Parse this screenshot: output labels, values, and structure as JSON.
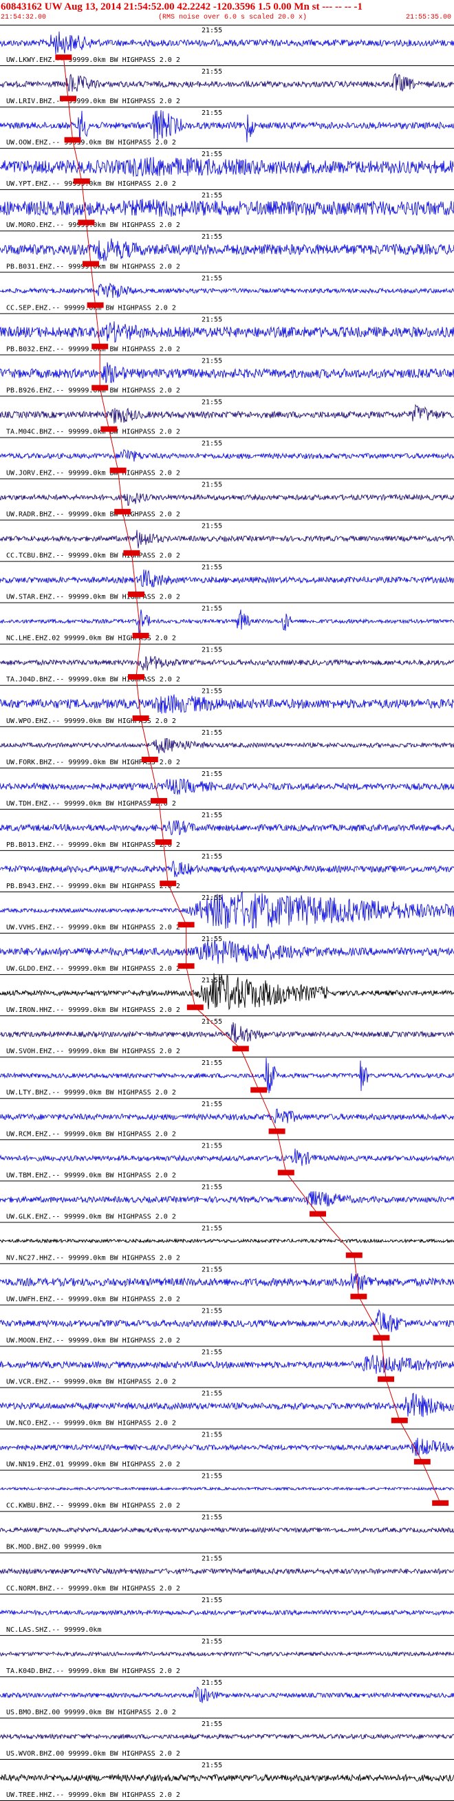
{
  "header": {
    "title": "60843162 UW Aug 13, 2014 21:54:52.00   42.2242 -120.3596  1.5 0.00 Mn st --- -- --  -1",
    "start_time": "21:54:32.00",
    "noise_note": "(RMS noise over 6.0 s scaled 20.0 x)",
    "end_time": "21:55:35.00"
  },
  "colors": {
    "trace_primary": "#1111dd",
    "trace_dark": "#22117a",
    "trace_black": "#000000",
    "pick": "#dd0000",
    "header_text": "#e00000"
  },
  "chart_data": {
    "type": "seismogram",
    "time_start": "21:54:32.00",
    "time_end": "21:55:35.00",
    "center_label": "21:55",
    "traces": [
      {
        "label": "UW.LKWY.EHZ.-- 99999.0km BW  HIGHPASS  2.0  2",
        "pick": 0.14,
        "color": "blue",
        "amp": 0.5,
        "bursts": [
          [
            0.1,
            0.22,
            2.2
          ]
        ]
      },
      {
        "label": "UW.LRIV.BHZ.-- 99999.0km BW  HIGHPASS  2.0  2",
        "pick": 0.15,
        "color": "dark",
        "amp": 0.45,
        "bursts": [
          [
            0.14,
            0.22,
            2.0
          ],
          [
            0.86,
            0.92,
            2.0
          ]
        ]
      },
      {
        "label": "UW.OOW.EHZ.-- 99999.0km BW  HIGHPASS  2.0  2",
        "pick": 0.16,
        "color": "blue",
        "amp": 0.5,
        "bursts": [
          [
            0.17,
            0.2,
            3.5
          ],
          [
            0.33,
            0.4,
            3.5
          ],
          [
            0.54,
            0.56,
            3.5
          ]
        ]
      },
      {
        "label": "UW.YPT.EHZ.-- 99999.0km BW  HIGHPASS  2.0  2",
        "pick": 0.18,
        "color": "blue",
        "amp": 1.0,
        "bursts": [
          [
            0.18,
            1.0,
            1.8
          ]
        ]
      },
      {
        "label": "UW.MORO.EHZ.-- 99999.0km BW  HIGHPASS  2.0  2",
        "pick": 0.19,
        "color": "blue",
        "amp": 1.1,
        "bursts": [
          [
            0.19,
            1.0,
            1.6
          ]
        ]
      },
      {
        "label": "PB.B031.EHZ.-- 99999.0km BW  HIGHPASS  2.0  2",
        "pick": 0.2,
        "color": "blue",
        "amp": 0.8,
        "bursts": [
          [
            0.2,
            0.35,
            2.2
          ]
        ]
      },
      {
        "label": "CC.SEP.EHZ.-- 99999.0km BW  HIGHPASS  2.0  2",
        "pick": 0.21,
        "color": "blue",
        "amp": 0.35,
        "bursts": [
          [
            0.21,
            0.3,
            1.8
          ]
        ]
      },
      {
        "label": "PB.B032.EHZ.-- 99999.0km BW  HIGHPASS  2.0  2",
        "pick": 0.22,
        "color": "blue",
        "amp": 0.8,
        "bursts": [
          [
            0.22,
            0.35,
            2.0
          ]
        ]
      },
      {
        "label": "PB.B926.EHZ.-- 99999.0km BW  HIGHPASS  2.0  2",
        "pick": 0.22,
        "color": "blue",
        "amp": 0.7,
        "bursts": [
          [
            0.22,
            0.3,
            2.0
          ]
        ]
      },
      {
        "label": "TA.M04C.BHZ.-- 99999.0km BW  HIGHPASS  2.0  2",
        "pick": 0.24,
        "color": "dark",
        "amp": 0.5,
        "bursts": [
          [
            0.24,
            0.32,
            1.8
          ],
          [
            0.9,
            0.98,
            1.8
          ]
        ]
      },
      {
        "label": "UW.JORV.EHZ.-- 99999.0km BW  HIGHPASS  2.0  2",
        "pick": 0.26,
        "color": "blue",
        "amp": 0.4,
        "bursts": [
          [
            0.26,
            0.32,
            1.6
          ]
        ]
      },
      {
        "label": "UW.RADR.BHZ.-- 99999.0km BW  HIGHPASS  2.0  2",
        "pick": 0.27,
        "color": "dark",
        "amp": 0.4,
        "bursts": [
          [
            0.27,
            0.33,
            1.6
          ]
        ]
      },
      {
        "label": "CC.TCBU.BHZ.-- 99999.0km BW  HIGHPASS  2.0  2",
        "pick": 0.29,
        "color": "dark",
        "amp": 0.4,
        "bursts": [
          [
            0.29,
            0.36,
            1.8
          ]
        ]
      },
      {
        "label": "UW.STAR.EHZ.-- 99999.0km BW  HIGHPASS  2.0  2",
        "pick": 0.3,
        "color": "blue",
        "amp": 0.45,
        "bursts": [
          [
            0.3,
            0.38,
            2.0
          ]
        ]
      },
      {
        "label": "NC.LHE.EHZ.02 99999.0km BW  HIGHPASS  2.0  2",
        "pick": 0.31,
        "color": "blue",
        "amp": 0.3,
        "bursts": [
          [
            0.3,
            0.33,
            2.5
          ],
          [
            0.52,
            0.55,
            2.5
          ],
          [
            0.62,
            0.64,
            2.5
          ]
        ]
      },
      {
        "label": "TA.J04D.BHZ.-- 99999.0km BW  HIGHPASS  2.0  2",
        "pick": 0.3,
        "color": "dark",
        "amp": 0.4,
        "bursts": [
          [
            0.3,
            0.4,
            1.5
          ]
        ]
      },
      {
        "label": "UW.WPO.EHZ.-- 99999.0km BW  HIGHPASS  2.0  2",
        "pick": 0.31,
        "color": "blue",
        "amp": 0.7,
        "bursts": [
          [
            0.31,
            0.6,
            1.8
          ]
        ]
      },
      {
        "label": "UW.FORK.BHZ.-- 99999.0km BW  HIGHPASS  2.0  2",
        "pick": 0.33,
        "color": "dark",
        "amp": 0.35,
        "bursts": [
          [
            0.33,
            0.45,
            1.5
          ]
        ]
      },
      {
        "label": "UW.TDH.EHZ.-- 99999.0km BW  HIGHPASS  2.0  2",
        "pick": 0.35,
        "color": "blue",
        "amp": 0.5,
        "bursts": [
          [
            0.35,
            0.5,
            1.6
          ]
        ]
      },
      {
        "label": "PB.B013.EHZ.-- 99999.0km BW  HIGHPASS  2.0  2",
        "pick": 0.36,
        "color": "blue",
        "amp": 0.5,
        "bursts": [
          [
            0.36,
            0.45,
            1.6
          ]
        ]
      },
      {
        "label": "PB.B943.EHZ.-- 99999.0km BW  HIGHPASS  2.0  2",
        "pick": 0.37,
        "color": "blue",
        "amp": 0.5,
        "bursts": [
          [
            0.37,
            0.45,
            1.6
          ]
        ]
      },
      {
        "label": "UW.VVHS.EHZ.-- 99999.0km BW  HIGHPASS  2.0  2",
        "pick": 0.41,
        "color": "blue",
        "amp": 0.3,
        "bursts": [
          [
            0.4,
            1.0,
            3.5
          ]
        ]
      },
      {
        "label": "UW.GLDO.EHZ.-- 99999.0km BW  HIGHPASS  2.0  2",
        "pick": 0.41,
        "color": "blue",
        "amp": 0.6,
        "bursts": [
          [
            0.41,
            0.75,
            2.2
          ]
        ]
      },
      {
        "label": "UW.IRON.HHZ.-- 99999.0km BW  HIGHPASS  2.0  2",
        "pick": 0.43,
        "color": "black",
        "amp": 0.4,
        "bursts": [
          [
            0.42,
            0.72,
            3.5
          ]
        ]
      },
      {
        "label": "UW.SVOH.EHZ.-- 99999.0km BW  HIGHPASS  2.0  2",
        "pick": 0.53,
        "color": "dark",
        "amp": 0.4,
        "bursts": [
          [
            0.5,
            0.58,
            2.2
          ]
        ]
      },
      {
        "label": "UW.LTY.BHZ.-- 99999.0km BW  HIGHPASS  2.0  2",
        "pick": 0.57,
        "color": "blue",
        "amp": 0.35,
        "bursts": [
          [
            0.58,
            0.61,
            4.0
          ],
          [
            0.79,
            0.81,
            3.5
          ]
        ]
      },
      {
        "label": "UW.RCM.EHZ.-- 99999.0km BW  HIGHPASS  2.0  2",
        "pick": 0.61,
        "color": "blue",
        "amp": 0.45,
        "bursts": [
          [
            0.6,
            0.66,
            2.0
          ]
        ]
      },
      {
        "label": "UW.TBM.EHZ.-- 99999.0km BW  HIGHPASS  2.0  2",
        "pick": 0.63,
        "color": "blue",
        "amp": 0.4,
        "bursts": [
          [
            0.64,
            0.7,
            1.8
          ]
        ]
      },
      {
        "label": "UW.GLK.EHZ.-- 99999.0km BW  HIGHPASS  2.0  2",
        "pick": 0.7,
        "color": "blue",
        "amp": 0.45,
        "bursts": [
          [
            0.66,
            0.8,
            1.6
          ]
        ]
      },
      {
        "label": "NV.NC27.HHZ.-- 99999.0km BW  HIGHPASS  2.0  2",
        "pick": 0.78,
        "color": "black",
        "amp": 0.25,
        "bursts": []
      },
      {
        "label": "UW.UWFH.EHZ.-- 99999.0km BW  HIGHPASS  2.0  2",
        "pick": 0.79,
        "color": "blue",
        "amp": 0.6,
        "bursts": [
          [
            0.76,
            0.86,
            1.8
          ]
        ]
      },
      {
        "label": "UW.MOON.EHZ.-- 99999.0km BW  HIGHPASS  2.0  2",
        "pick": 0.84,
        "color": "blue",
        "amp": 0.5,
        "bursts": [
          [
            0.82,
            0.9,
            2.5
          ]
        ]
      },
      {
        "label": "UW.VCR.EHZ.-- 99999.0km BW  HIGHPASS  2.0  2",
        "pick": 0.85,
        "color": "blue",
        "amp": 0.5,
        "bursts": [
          [
            0.78,
            1.0,
            1.8
          ]
        ]
      },
      {
        "label": "UW.NCO.EHZ.-- 99999.0km BW  HIGHPASS  2.0  2",
        "pick": 0.88,
        "color": "blue",
        "amp": 0.5,
        "bursts": [
          [
            0.88,
            1.0,
            2.5
          ]
        ]
      },
      {
        "label": "UW.NN19.EHZ.01 99999.0km BW  HIGHPASS  2.0  2",
        "pick": 0.93,
        "color": "blue",
        "amp": 0.4,
        "bursts": [
          [
            0.9,
            1.0,
            1.8
          ]
        ]
      },
      {
        "label": "CC.KWBU.BHZ.-- 99999.0km BW  HIGHPASS  2.0  2",
        "pick": 0.97,
        "color": "blue",
        "amp": 0.2,
        "bursts": []
      },
      {
        "label": "BK.MOD.BHZ.00 99999.0km",
        "pick": null,
        "color": "dark",
        "amp": 0.35,
        "bursts": []
      },
      {
        "label": "CC.NORM.BHZ.-- 99999.0km BW  HIGHPASS  2.0  2",
        "pick": null,
        "color": "dark",
        "amp": 0.4,
        "bursts": []
      },
      {
        "label": "NC.LAS.SHZ.-- 99999.0km",
        "pick": null,
        "color": "blue",
        "amp": 0.35,
        "bursts": []
      },
      {
        "label": "TA.K04D.BHZ.-- 99999.0km BW  HIGHPASS  2.0  2",
        "pick": null,
        "color": "dark",
        "amp": 0.3,
        "bursts": []
      },
      {
        "label": "US.BMO.BHZ.00 99999.0km BW  HIGHPASS  2.0  2",
        "pick": null,
        "color": "blue",
        "amp": 0.35,
        "bursts": [
          [
            0.42,
            0.48,
            1.8
          ]
        ]
      },
      {
        "label": "US.WVOR.BHZ.00 99999.0km BW  HIGHPASS  2.0  2",
        "pick": null,
        "color": "dark",
        "amp": 0.35,
        "bursts": []
      },
      {
        "label": "UW.TREE.HHZ.-- 99999.0km BW  HIGHPASS  2.0  2",
        "pick": null,
        "color": "black",
        "amp": 0.5,
        "bursts": []
      }
    ]
  }
}
